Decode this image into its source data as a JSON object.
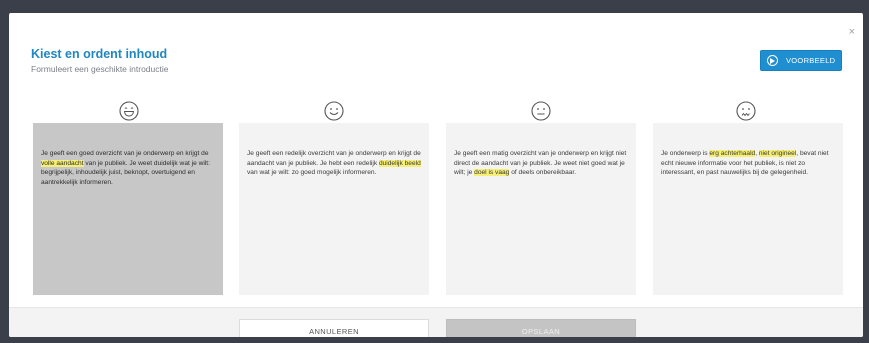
{
  "dialog": {
    "title": "Kiest en ordent inhoud",
    "subtitle": "Formuleert een geschikte introductie",
    "close_glyph": "×",
    "example_button": {
      "label": "VOORBEELD",
      "icon": "play-circle-icon",
      "color": "#1f8fd1"
    }
  },
  "levels": [
    {
      "icon": "laughing-face-icon",
      "selected": true,
      "segments": [
        {
          "text": "Je geeft een goed overzicht van je onderwerp en krijgt de "
        },
        {
          "text": "volle aandacht",
          "highlight": true
        },
        {
          "text": " van je publiek. Je weet duidelijk wat je wilt: begrijpelijk, inhoudelijk juist, beknopt, overtuigend en aantrekkelijk informeren."
        }
      ]
    },
    {
      "icon": "smiling-face-icon",
      "selected": false,
      "segments": [
        {
          "text": "Je geeft een redelijk overzicht van je onderwerp en krijgt de aandacht van je publiek. Je hebt een redelijk "
        },
        {
          "text": "duidelijk beeld",
          "highlight": true
        },
        {
          "text": " van wat je wilt: zo goed mogelijk informeren."
        }
      ]
    },
    {
      "icon": "neutral-face-icon",
      "selected": false,
      "segments": [
        {
          "text": "Je geeft een matig overzicht van je onderwerp en krijgt niet direct de aandacht van je publiek. Je weet niet goed wat je wilt; je "
        },
        {
          "text": "doel is vaag",
          "highlight": true
        },
        {
          "text": " of deels onbereikbaar."
        }
      ]
    },
    {
      "icon": "worried-face-icon",
      "selected": false,
      "segments": [
        {
          "text": "Je onderwerp is "
        },
        {
          "text": "erg achterhaald",
          "highlight": true
        },
        {
          "text": ", "
        },
        {
          "text": "niet origineel",
          "highlight": true
        },
        {
          "text": ", bevat niet echt nieuwe informatie voor het publiek, is niet zo interessant, en past nauwelijks bij de gelegenheid."
        }
      ]
    }
  ],
  "footer": {
    "cancel_label": "ANNULEREN",
    "save_label": "OPSLAAN",
    "save_disabled": true
  },
  "colors": {
    "accent": "#1f86c0",
    "highlight": "#f6ef75",
    "selected_card": "#c7c7c7",
    "card": "#f3f3f3"
  }
}
